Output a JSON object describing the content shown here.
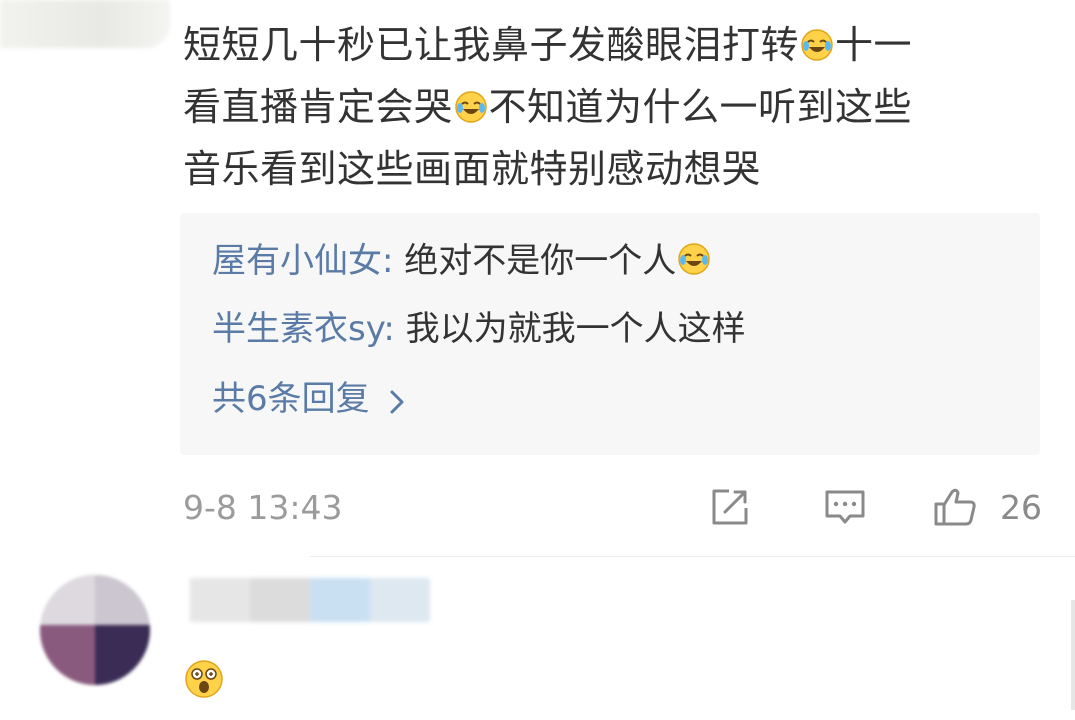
{
  "comment": {
    "line1": "短短几十秒已让我鼻子发酸眼泪打转",
    "line1_after_emoji": "十一",
    "line2": "看直播肯定会哭",
    "line2_after_emoji": "不知道为什么一听到这些",
    "line3": "音乐看到这些画面就特别感动想哭",
    "emoji_name": "laughing-crying-emoji"
  },
  "replies": {
    "items": [
      {
        "user": "屋有小仙女",
        "colon": ":",
        "text": "绝对不是你一个人",
        "has_emoji": true
      },
      {
        "user": "半生素衣sy",
        "colon": ":",
        "text": "我以为就我一个人这样",
        "has_emoji": false
      }
    ],
    "more_label": "共6条回复"
  },
  "meta": {
    "timestamp": "9-8 13:43",
    "like_count": "26"
  },
  "icons": {
    "share": "share-edit-icon",
    "reply": "comment-bubble-icon",
    "like": "thumbs-up-icon",
    "chevron": "chevron-right-icon"
  },
  "colors": {
    "username": "#5a7ba6",
    "text": "#333333",
    "meta": "#9b9b9b",
    "reply_bg": "#f7f7f7",
    "icon": "#8a8a8a"
  }
}
